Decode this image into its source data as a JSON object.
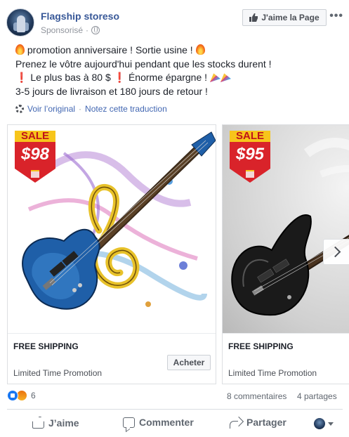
{
  "header": {
    "page_name": "Flagship storeso",
    "sponsored": "Sponsorisé",
    "like_page_label": "J'aime la Page",
    "more": "•••"
  },
  "post": {
    "line1": "promotion anniversaire ! Sortie usine !",
    "line2": "Prenez le vôtre aujourd'hui pendant que les stocks durent !",
    "line3a": "Le plus bas à 80 $",
    "line3b": "Énorme épargne !",
    "line4": "3-5 jours de livraison et 180 jours de retour !"
  },
  "translation": {
    "see_original": "Voir l’original",
    "separator": "·",
    "rate": "Notez cette traduction"
  },
  "cards": [
    {
      "sale_label": "SALE",
      "price": "$98",
      "shipping": "FREE SHIPPING",
      "promo": "Limited Time Promotion",
      "buy_label": "Acheter",
      "guitar_color": "#1f5fa8"
    },
    {
      "sale_label": "SALE",
      "price": "$95",
      "shipping": "FREE SHIPPING",
      "promo": "Limited Time Promotion",
      "guitar_color": "#1a1a1a"
    }
  ],
  "stats": {
    "reaction_count": "6",
    "comments": "8 commentaires",
    "shares": "4 partages"
  },
  "actions": {
    "like": "J’aime",
    "comment": "Commenter",
    "share": "Partager"
  },
  "colors": {
    "link": "#385898",
    "sale_red": "#d9232a",
    "sale_yellow": "#f7c51b"
  }
}
